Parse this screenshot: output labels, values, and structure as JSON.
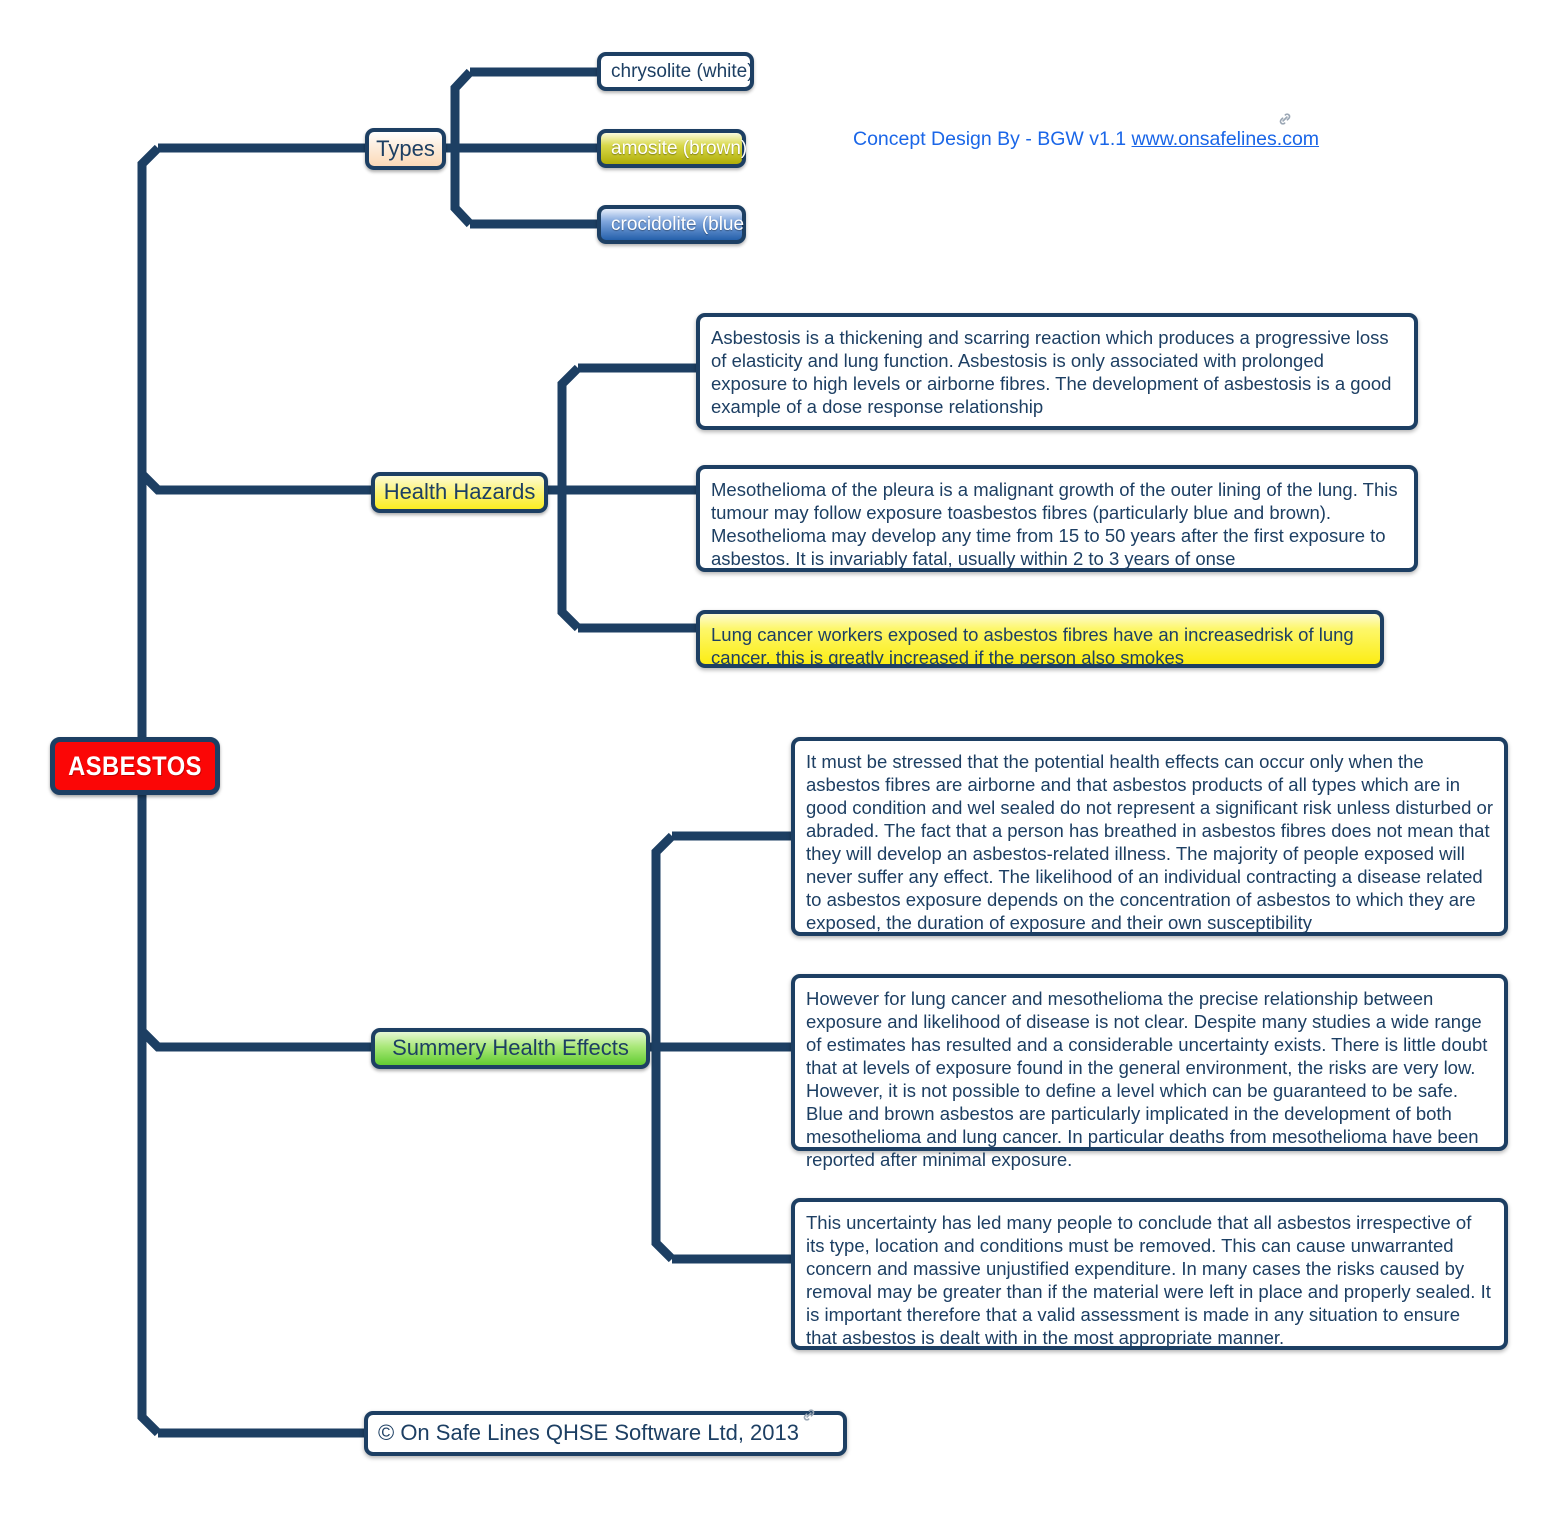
{
  "meta": {
    "title": "ASBESTOS",
    "accent_border": "#1d3f63",
    "root_fill": "#fb0606",
    "text_color": "#1d3f63",
    "link_color": "#1a66e8"
  },
  "credit": {
    "prefix": "Concept Design By - BGW v1.1 ",
    "url_text": "www.onsafelines.com",
    "link_icon": "link-icon"
  },
  "root": {
    "label": "ASBESTOS"
  },
  "branches": {
    "types": {
      "label": "Types",
      "children": [
        {
          "label": "chrysolite (white)",
          "style": "white"
        },
        {
          "label": "amosite (brown)",
          "style": "amosite"
        },
        {
          "label": "crocidolite (blue",
          "style": "crocidolite"
        }
      ]
    },
    "health_hazards": {
      "label": "Health Hazards",
      "children": [
        {
          "style": "white",
          "text": "Asbestosis is a thickening and scarring reaction which produces a progressive loss of elasticity and lung function. Asbestosis is only associated with prolonged exposure to high levels or airborne fibres. The development of asbestosis is a good example of a dose response relationship"
        },
        {
          "style": "white",
          "text": "Mesothelioma of the pleura is a malignant growth of the outer lining of the lung. This tumour may follow exposure toasbestos fibres (particularly blue and brown). Mesothelioma may develop any time from 15 to 50 years after the first exposure to asbestos. It is invariably fatal, usually within 2 to 3 years of onse"
        },
        {
          "style": "yellow",
          "text": "Lung cancer workers exposed to asbestos fibres have an increasedrisk of lung cancer, this is greatly increased if the person also smokes"
        }
      ]
    },
    "summary_health_effects": {
      "label": "Summery Health Effects",
      "children": [
        {
          "style": "white",
          "text": "It must be stressed that the potential health effects can occur only when the asbestos fibres are airborne and that asbestos products of all types which are in good condition and wel sealed do not represent a significant risk unless disturbed or abraded. The fact that a person has breathed in asbestos fibres does not mean that they will develop an asbestos-related illness. The majority of people exposed will never suffer any effect. The likelihood of an individual contracting a disease related to asbestos exposure depends on the concentration of asbestos to which they are exposed, the duration of exposure and their own susceptibility"
        },
        {
          "style": "white",
          "text": "However for lung cancer and mesothelioma the precise relationship between exposure and likelihood of disease is not clear. Despite many studies a wide range of estimates has resulted and a considerable uncertainty exists. There is little doubt that at levels of exposure found in the general environment, the risks are very low. However, it is not possible to define a level which can be guaranteed to be safe. Blue and brown asbestos are particularly implicated in the development of both mesothelioma and lung cancer. In particular deaths from mesothelioma have been reported after minimal exposure."
        },
        {
          "style": "white",
          "text": "This uncertainty has led many people to conclude that all asbestos irrespective of its type, location and conditions must be removed. This can cause unwarranted concern and massive unjustified expenditure. In many cases the risks caused by removal may be greater than if the material were left in place and properly sealed. It is important therefore that a valid assessment is made in any situation to ensure that asbestos is dealt with in the most appropriate manner."
        }
      ]
    }
  },
  "footer": {
    "label": "© On Safe Lines QHSE Software Ltd, 2013",
    "link_icon": "link-icon"
  }
}
